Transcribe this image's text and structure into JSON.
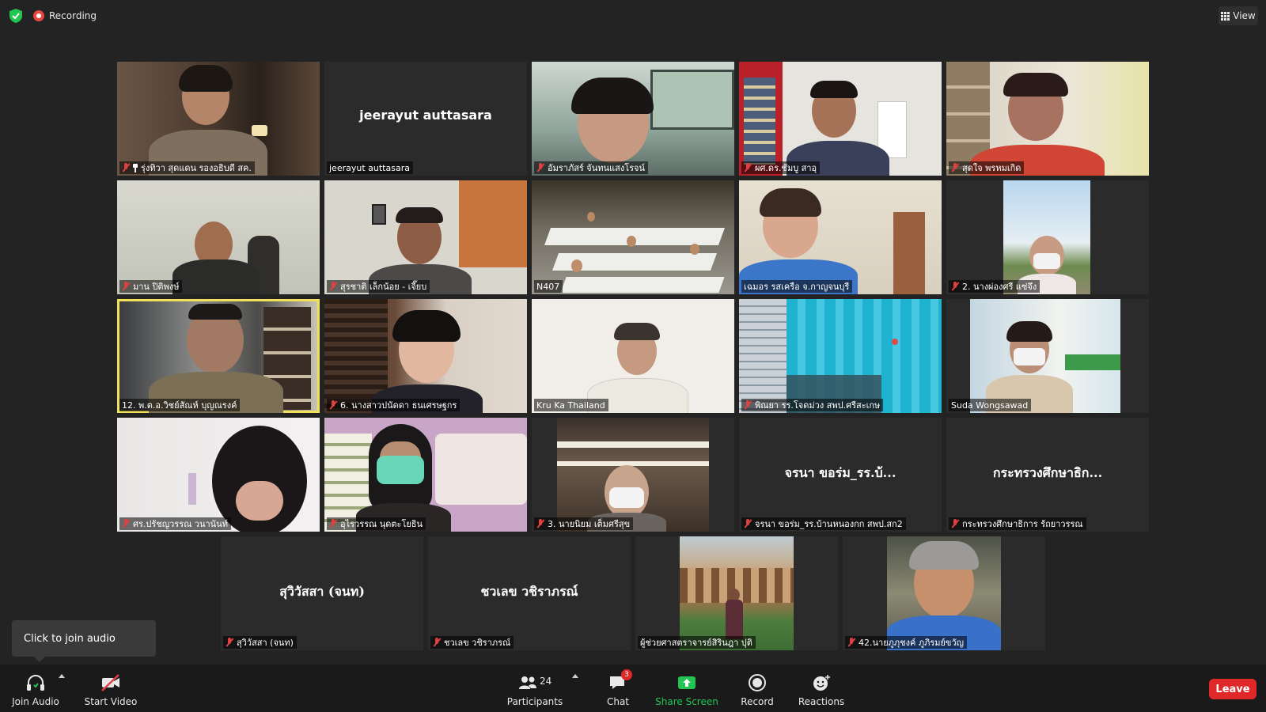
{
  "topbar": {
    "recording_label": "Recording",
    "view_label": "View"
  },
  "tiles": [
    {
      "name": "รุ่งทิวา สุดแดน รองอธิบดี สค.",
      "video": true,
      "muted": true,
      "pinned": true
    },
    {
      "name": "jeerayut auttasara",
      "display": "jeerayut auttasara",
      "video": false,
      "muted": false
    },
    {
      "name": "อัมราภัสร์ จันทนแสงโรจน์",
      "video": true,
      "muted": true
    },
    {
      "name": "ผศ.ดร.ชัมบู สาอุ",
      "video": true,
      "muted": true
    },
    {
      "name": "สุดใจ พรหมเกิด",
      "video": true,
      "muted": true
    },
    {
      "name": "มาน ปิติพงษ์",
      "video": true,
      "muted": true
    },
    {
      "name": "สุรชาติ เล็กน้อย - เจี๊ยบ",
      "video": true,
      "muted": true
    },
    {
      "name": "N407",
      "video": true,
      "muted": false
    },
    {
      "name": "เฉมอร รสเครือ จ.กาญจนบุรี",
      "video": true,
      "muted": false
    },
    {
      "name": "2. นางผ่องศรี แซ่จึง",
      "video": true,
      "muted": true
    },
    {
      "name": "12. พ.ต.อ.วิชย์สัณห์ บุญณรงค์",
      "video": true,
      "muted": false,
      "active": true
    },
    {
      "name": "6. นางสาวปนัดดา ธนเศรษฐกร",
      "video": true,
      "muted": true
    },
    {
      "name": "Kru Ka Thailand",
      "video": true,
      "muted": false
    },
    {
      "name": "พิณยา รร.โจดม่วง สพป.ศรีสะเกษ",
      "video": true,
      "muted": true
    },
    {
      "name": "Suda Wongsawad",
      "video": true,
      "muted": false
    },
    {
      "name": "ศร.ปรัชญวรรณ วนานันท์",
      "video": true,
      "muted": true
    },
    {
      "name": "อุไรวรรณ นุดตะโยธิน",
      "video": true,
      "muted": true
    },
    {
      "name": "3. นายนิยม เต็มศรีสุข",
      "video": true,
      "muted": true
    },
    {
      "name": "จรนา ขอร่ม_รร.บ้านหนองกก สพป.สก2",
      "display": "จรนา ขอร่ม_รร.บ้...",
      "video": false,
      "muted": true
    },
    {
      "name": "กระทรวงศึกษาธิการ รัถยาวรรณ",
      "display": "กระทรวงศึกษาธิก...",
      "video": false,
      "muted": true
    },
    {
      "name": "สุวิวัสสา (จนท)",
      "display": "สุวิวัสสา (จนท)",
      "video": false,
      "muted": true
    },
    {
      "name": "ชวเลข วชิราภรณ์",
      "display": "ชวเลข วชิราภรณ์",
      "video": false,
      "muted": true
    },
    {
      "name": "ผู้ช่วยศาสตราจารย์สิรินฎา ปุติ",
      "video": true,
      "muted": false
    },
    {
      "name": "42.นายภูภุชงค์ ภูภิรมย์ขวัญ",
      "video": true,
      "muted": true
    }
  ],
  "tooltip": {
    "text": "Click to join audio"
  },
  "toolbar": {
    "join_audio": "Join Audio",
    "start_video": "Start Video",
    "participants_label": "Participants",
    "participants_count": "24",
    "chat_label": "Chat",
    "chat_badge": "3",
    "share_label": "Share Screen",
    "record_label": "Record",
    "reactions_label": "Reactions",
    "leave_label": "Leave"
  },
  "colors": {
    "background": "#232323",
    "tile": "#2b2b2b",
    "active_speaker": "#f1e05a",
    "share_green": "#23c552",
    "leave_red": "#e02828",
    "muted_red": "#e04040"
  },
  "icons": [
    "shield-icon",
    "recording-icon",
    "grid-view-icon",
    "muted-mic-icon",
    "pin-icon",
    "headphones-icon",
    "video-off-icon",
    "participants-icon",
    "chat-icon",
    "share-screen-icon",
    "record-icon",
    "reactions-icon"
  ]
}
